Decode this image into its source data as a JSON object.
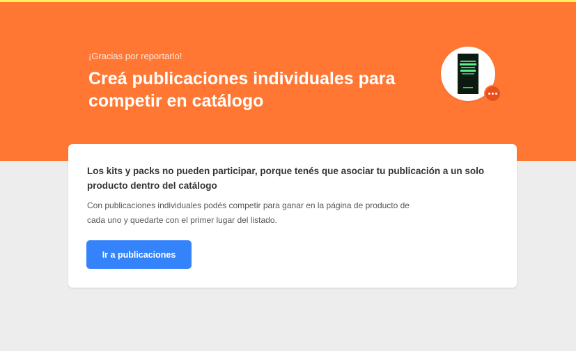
{
  "header": {
    "eyebrow": "¡Gracias por reportarlo!",
    "title": "Creá publicaciones individuales para competir en catálogo",
    "product_thumbnail_icon": "book-cover-icon",
    "badge_icon": "more-dots-icon"
  },
  "card": {
    "title": "Los kits y packs no pueden participar, porque tenés que asociar tu publicación a un solo producto dentro del catálogo",
    "body": "Con publicaciones individuales podés competir para ganar en la página de producto de cada uno y quedarte con el primer lugar del listado.",
    "button_label": "Ir a publicaciones"
  },
  "colors": {
    "hero": "#ff7733",
    "accent_bar": "#fff159",
    "button": "#3483fa",
    "badge": "#e8511f",
    "background": "#ededed"
  }
}
